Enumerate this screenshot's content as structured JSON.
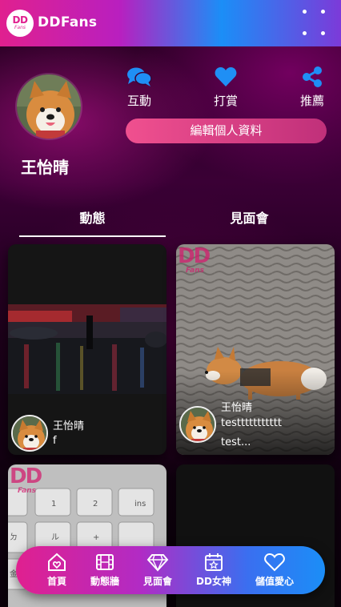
{
  "app": {
    "logo_main": "DD",
    "logo_sub": "Fans",
    "title": "DDFans"
  },
  "profile": {
    "name": "王怡晴",
    "actions": [
      {
        "label": "互動",
        "icon": "chat-icon"
      },
      {
        "label": "打賞",
        "icon": "heart-icon"
      },
      {
        "label": "推薦",
        "icon": "share-icon"
      }
    ],
    "edit_label": "編輯個人資料"
  },
  "tabs": [
    {
      "label": "動態",
      "active": true
    },
    {
      "label": "見面會",
      "active": false
    }
  ],
  "watermark": {
    "main": "DD",
    "sub": "Fans"
  },
  "posts": [
    {
      "author": "王怡晴",
      "text": "f"
    },
    {
      "author": "王怡晴",
      "text_line1": "testtttttttttt",
      "text_line2": "test..."
    }
  ],
  "bottom_nav": [
    {
      "label": "首頁",
      "icon": "home-icon"
    },
    {
      "label": "動態牆",
      "icon": "film-icon"
    },
    {
      "label": "見面會",
      "icon": "diamond-icon"
    },
    {
      "label": "DD女神",
      "icon": "calendar-icon"
    },
    {
      "label": "儲值愛心",
      "icon": "heart-outline-icon"
    }
  ],
  "colors": {
    "accent_pink": "#e0208f",
    "accent_blue": "#1b8ef7",
    "icon_blue": "#1f8ff5"
  }
}
